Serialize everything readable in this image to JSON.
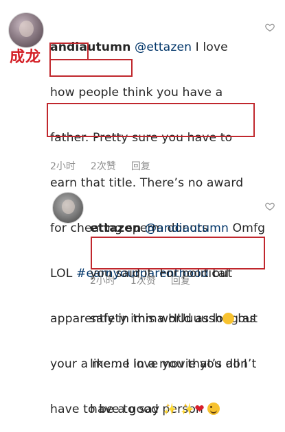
{
  "annotation_label": "成龙",
  "comment_1": {
    "lines": [
      {
        "username": "andiautumn",
        "mention": "@ettazen",
        "text": " I love"
      },
      {
        "text": "how people think you have a"
      },
      {
        "text": "father. Pretty sure you have to"
      },
      {
        "text": "earn that title. There’s no award"
      },
      {
        "text": "for cheating sperm donors"
      },
      {
        "prefix": "LOL ",
        "hashtag": "#earnyourparenthood",
        "text": " but"
      },
      {
        "text": "apparently in this world as long as"
      },
      {
        "text": "your a meme in a movie you don’t"
      },
      {
        "text": "have to be a good person"
      }
    ],
    "time": "2小时",
    "likes": "2次赞",
    "reply": "回复"
  },
  "comment_2": {
    "lines": [
      {
        "username": "ettazen",
        "mention": "@andiautumn",
        "text": " Omfg"
      },
      {
        "text": "you said it. For political"
      },
      {
        "text": "safety imma HUuuush",
        "suffix": " but"
      },
      {
        "text": "like... I love you that’s all I"
      },
      {
        "text": "have to say"
      }
    ],
    "time": "2小时",
    "likes": "1次赞",
    "reply": "回复"
  },
  "colors": {
    "highlight_box": "#c0272d",
    "annotation": "#d42027",
    "link": "#003569",
    "meta": "#8e8e8e"
  },
  "icons": [
    "heart-outline-icon",
    "wink-emoji",
    "laughing-emoji",
    "sparkles-emoji",
    "red-heart-emoji"
  ]
}
